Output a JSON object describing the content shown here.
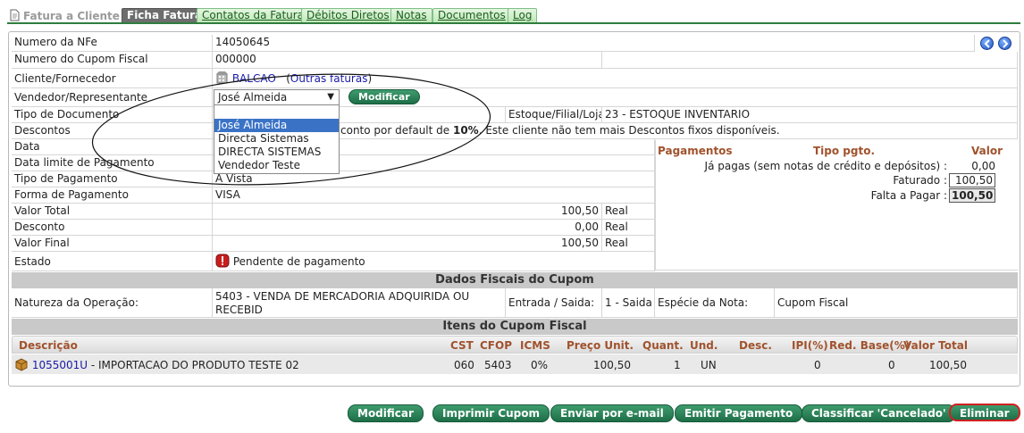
{
  "tabs": {
    "title": "Fatura a Cliente",
    "items": [
      "Ficha Fatura",
      "Contatos da Fatura",
      "Débitos Diretos",
      "Notas",
      "Documentos",
      "Log"
    ]
  },
  "fields": {
    "nfe": {
      "label": "Numero da NFe",
      "value": "14050645"
    },
    "cupom": {
      "label": "Numero do Cupom Fiscal",
      "value": "000000"
    },
    "cliente": {
      "label": "Cliente/Fornecedor",
      "value": "BALCAO",
      "other": "Outras faturas",
      "paren_open": "(",
      "paren_close": ")"
    },
    "vendedor": {
      "label": "Vendedor/Representante",
      "value": "José Almeida",
      "modify": "Modificar"
    },
    "tipo_doc": {
      "label": "Tipo de Documento",
      "estoque_label": "Estoque/Filial/Loja",
      "estoque_value": "23 - ESTOQUE INVENTARIO"
    },
    "descontos": {
      "label": "Descontos",
      "text_a": "conto por default de ",
      "pct": "10%",
      "text_b": ". Este cliente não tem mais Descontos fixos disponíveis."
    },
    "data": {
      "label": "Data"
    },
    "data_limite": {
      "label": "Data limite de Pagamento"
    },
    "tipo_pag": {
      "label": "Tipo de Pagamento",
      "value": "A Vista"
    },
    "forma_pag": {
      "label": "Forma de Pagamento",
      "value": "VISA"
    },
    "valor_total": {
      "label": "Valor Total",
      "value": "100,50",
      "unit": "Real"
    },
    "desconto": {
      "label": "Desconto",
      "value": "0,00",
      "unit": "Real"
    },
    "valor_final": {
      "label": "Valor Final",
      "value": "100,50",
      "unit": "Real"
    },
    "estado": {
      "label": "Estado",
      "value": "Pendente de pagamento"
    }
  },
  "dropdown": {
    "options": [
      "José Almeida",
      "Directa Sistemas",
      "DIRECTA SISTEMAS",
      "Vendedor Teste"
    ],
    "selected_index": 0
  },
  "pagamentos": {
    "h_pag": "Pagamentos",
    "h_tipo": "Tipo pgto.",
    "h_valor": "Valor",
    "ja_pagas_label": "Já pagas (sem notas de crédito e depósitos) :",
    "ja_pagas_value": "0,00",
    "faturado_label": "Faturado :",
    "faturado_value": "100,50",
    "falta_label": "Falta a Pagar :",
    "falta_value": "100,50"
  },
  "fiscal": {
    "title": "Dados Fiscais do Cupom",
    "natureza_label": "Natureza da Operação:",
    "natureza_value_1": "5403 - VENDA DE MERCADORIA ADQUIRIDA OU",
    "natureza_value_2": "RECEBID",
    "entrada_label": "Entrada / Saida:",
    "entrada_value": "1 - Saida",
    "especie_label": "Espécie da Nota:",
    "especie_value": "Cupom Fiscal"
  },
  "items": {
    "title": "Itens do Cupom Fiscal",
    "headers": {
      "descricao": "Descrição",
      "cst": "CST",
      "cfop": "CFOP",
      "icms": "ICMS",
      "preco": "Preço Unit.",
      "quant": "Quant.",
      "und": "Und.",
      "desc": "Desc.",
      "ipi": "IPI(%)",
      "red": "Red. Base(%)",
      "total": "Valor Total"
    },
    "row": {
      "code": "1055001U",
      "name": " - IMPORTACAO DO PRODUTO TESTE 02",
      "cst": "060",
      "cfop": "5403",
      "icms": "0%",
      "preco": "100,50",
      "quant": "1",
      "und": "UN",
      "ipi": "0",
      "red": "0",
      "total": "100,50"
    }
  },
  "buttons": {
    "modificar": "Modificar",
    "imprimir": "Imprimir Cupom",
    "enviar": "Enviar por e-mail",
    "emitir": "Emitir Pagamento",
    "classificar": "Classificar 'Cancelado'",
    "eliminar": "Eliminar"
  },
  "colors": {
    "accent": "#2f7d3e",
    "button": "#1e6e48",
    "header_text": "#a0522d",
    "danger": "#d22020"
  }
}
